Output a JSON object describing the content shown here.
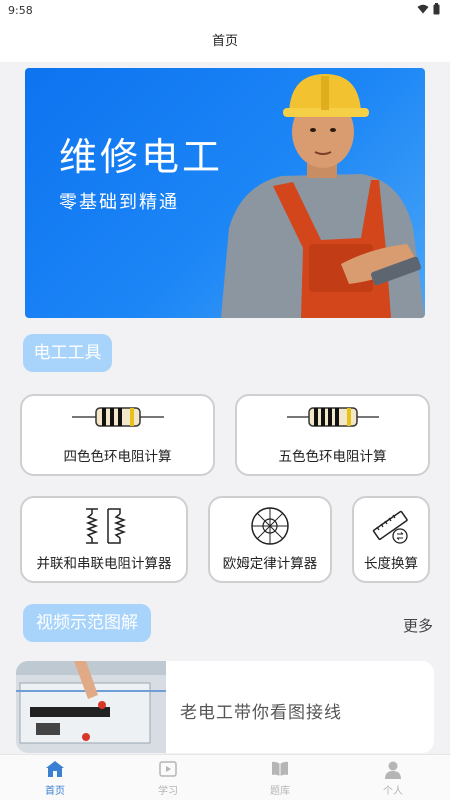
{
  "status_bar": {
    "time": "9:58"
  },
  "header": {
    "title": "首页"
  },
  "banner": {
    "title": "维修电工",
    "subtitle": "零基础到精通"
  },
  "tools_section": {
    "title": "电工工具",
    "tools": [
      {
        "label": "四色色环电阻计算"
      },
      {
        "label": "五色色环电阻计算"
      },
      {
        "label": "并联和串联电阻计算器"
      },
      {
        "label": "欧姆定律计算器"
      },
      {
        "label": "长度换算"
      }
    ]
  },
  "video_section": {
    "title": "视频示范图解",
    "more": "更多",
    "items": [
      {
        "title": "老电工带你看图接线"
      }
    ]
  },
  "tab_bar": {
    "items": [
      {
        "label": "首页",
        "icon": "home-icon",
        "active": true
      },
      {
        "label": "学习",
        "icon": "play-icon",
        "active": false
      },
      {
        "label": "题库",
        "icon": "book-icon",
        "active": false
      },
      {
        "label": "个人",
        "icon": "person-icon",
        "active": false
      }
    ],
    "active_color": "#3b7fd3",
    "inactive_color": "#b5b5b5"
  },
  "colors": {
    "banner_blue": "#1c86f6",
    "pill_blue": "#a8d4fb"
  }
}
